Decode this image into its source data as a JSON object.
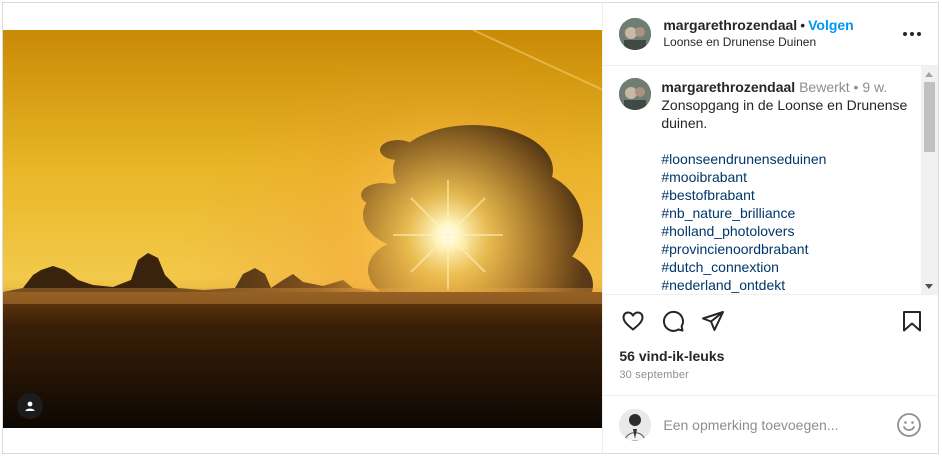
{
  "post": {
    "username": "margarethrozendaal",
    "follow_label": "Volgen",
    "location": "Loonse en Drunense Duinen",
    "caption": {
      "username": "margarethrozendaal",
      "edited": "Bewerkt",
      "age": "9 w.",
      "text": "Zonsopgang in de Loonse en Drunense duinen.",
      "hashtags": [
        "#loonseendrunenseduinen",
        "#mooibrabant",
        "#bestofbrabant",
        "#nb_nature_brilliance",
        "#holland_photolovers",
        "#provincienoordbrabant",
        "#dutch_connextion",
        "#nederland_ontdekt"
      ]
    },
    "likes": "56 vind-ik-leuks",
    "date": "30 september",
    "comment_placeholder": "Een opmerking toevoegen...",
    "separator": "•"
  },
  "icons": {
    "more": "more-options-icon",
    "like": "heart-icon",
    "comment": "comment-bubble-icon",
    "share": "paper-plane-icon",
    "save": "bookmark-icon",
    "emoji": "smiley-icon",
    "tag": "user-tag-icon"
  },
  "colors": {
    "accent": "#0095f6",
    "hashtag": "#00376b",
    "muted": "#8e8e8e",
    "text": "#262626"
  }
}
